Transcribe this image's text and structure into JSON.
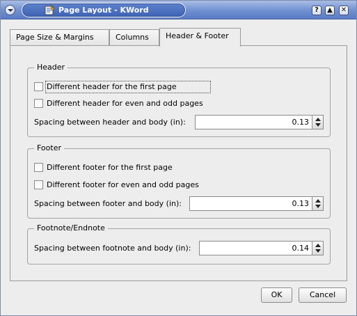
{
  "window": {
    "title": "Page Layout - KWord",
    "buttons": {
      "help": "?",
      "maximize": "▲",
      "close": "✕"
    }
  },
  "tabs": [
    {
      "label": "Page Size & Margins",
      "active": false
    },
    {
      "label": "Columns",
      "active": false
    },
    {
      "label": "Header & Footer",
      "active": true
    }
  ],
  "header_group": {
    "title": "Header",
    "check_first": {
      "label": "Different header for the first page",
      "checked": false
    },
    "check_even_odd": {
      "label": "Different header for even and odd pages",
      "checked": false
    },
    "spacing_label": "Spacing between header and body (in):",
    "spacing_value": "0.13"
  },
  "footer_group": {
    "title": "Footer",
    "check_first": {
      "label": "Different footer for the first page",
      "checked": false
    },
    "check_even_odd": {
      "label": "Different footer for even and odd pages",
      "checked": false
    },
    "spacing_label": "Spacing between footer and body (in):",
    "spacing_value": "0.13"
  },
  "footnote_group": {
    "title": "Footnote/Endnote",
    "spacing_label": "Spacing between footnote and body (in):",
    "spacing_value": "0.14"
  },
  "buttons": {
    "ok": "OK",
    "cancel": "Cancel"
  }
}
